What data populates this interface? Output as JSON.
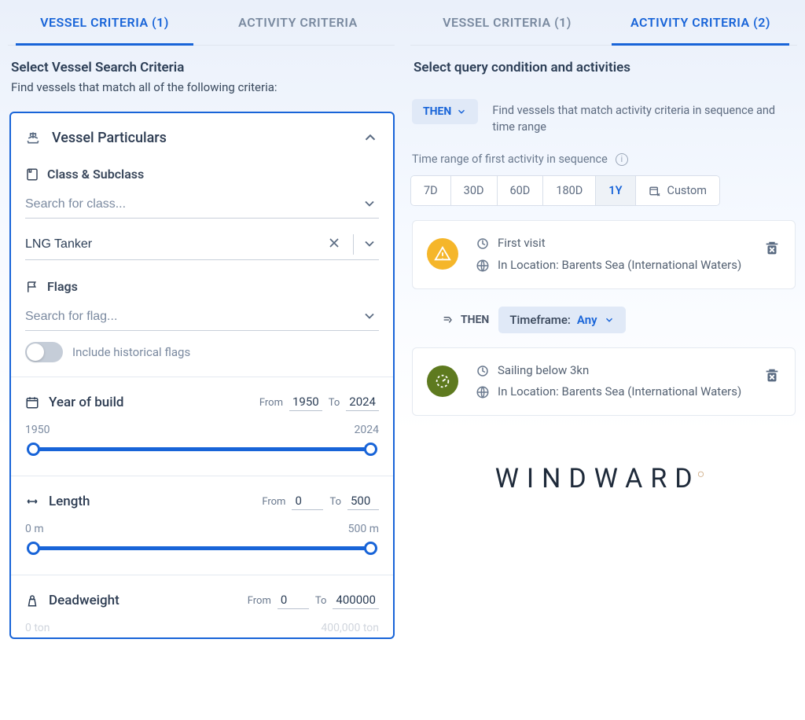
{
  "left": {
    "tabs": [
      {
        "label": "VESSEL CRITERIA (1)",
        "active": true
      },
      {
        "label": "ACTIVITY CRITERIA",
        "active": false
      }
    ],
    "header": {
      "title": "Select Vessel Search Criteria",
      "subtitle": "Find vessels that match all of the following criteria:"
    },
    "accordion": {
      "title": "Vessel Particulars"
    },
    "class": {
      "label": "Class & Subclass",
      "search_placeholder": "Search for class...",
      "selected_value": "LNG Tanker"
    },
    "flags": {
      "label": "Flags",
      "search_placeholder": "Search for flag...",
      "historical_label": "Include historical flags"
    },
    "year": {
      "label": "Year of build",
      "from_label": "From",
      "from_value": "1950",
      "to_label": "To",
      "to_value": "2024",
      "min_label": "1950",
      "max_label": "2024"
    },
    "length": {
      "label": "Length",
      "from_label": "From",
      "from_value": "0",
      "to_label": "To",
      "to_value": "500",
      "min_label": "0 m",
      "max_label": "500 m"
    },
    "deadweight": {
      "label": "Deadweight",
      "from_label": "From",
      "from_value": "0",
      "to_label": "To",
      "to_value": "400000",
      "min_label": "0 ton",
      "max_label": "400,000 ton"
    }
  },
  "right": {
    "tabs": [
      {
        "label": "VESSEL CRITERIA (1)",
        "active": false
      },
      {
        "label": "ACTIVITY CRITERIA (2)",
        "active": true
      }
    ],
    "header": {
      "title": "Select query condition and activities"
    },
    "then_label": "THEN",
    "cond_desc": "Find vessels that match activity criteria in sequence and time range",
    "timerange_label": "Time range of first activity in sequence",
    "chips": [
      "7D",
      "30D",
      "60D",
      "180D",
      "1Y"
    ],
    "chips_selected": "1Y",
    "custom_label": "Custom",
    "activity1": {
      "line1": "First visit",
      "line2": "In Location: Barents Sea (International Waters)"
    },
    "seq": {
      "then": "THEN",
      "tf_label": "Timeframe:",
      "tf_value": "Any"
    },
    "activity2": {
      "line1": "Sailing below 3kn",
      "line2": "In Location: Barents Sea (International Waters)"
    },
    "brand": "WINDWARD"
  }
}
